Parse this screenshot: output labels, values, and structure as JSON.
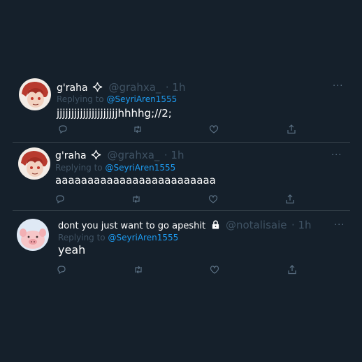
{
  "tweets": [
    {
      "display_name": "g'raha",
      "handle": "@grahxa_",
      "time": "· 1h",
      "replying_prefix": "Replying to ",
      "replying_to": "@SeyriAren1555",
      "text": "jjjjjjjjjjjjjjjjjjjjjhhhhg;//2;",
      "more": "···",
      "icons": [
        "reply-icon",
        "retweet-icon",
        "like-icon",
        "share-icon"
      ]
    },
    {
      "display_name": "g'raha",
      "handle": "@grahxa_",
      "time": "· 1h",
      "replying_prefix": "Replying to ",
      "replying_to": "@SeyriAren1555",
      "text": "aaaaaaaaaaaaaaaaaaaaaaaaa",
      "more": "···",
      "icons": [
        "reply-icon",
        "retweet-icon",
        "like-icon",
        "share-icon"
      ]
    },
    {
      "display_name": "dont you just want to go apeshit",
      "handle": "@notalisaie",
      "time": "· 1h",
      "replying_prefix": "Replying to ",
      "replying_to": "@SeyriAren1555",
      "text": "yeah",
      "more": "···",
      "icons": [
        "reply-icon",
        "retweet-icon",
        "like-icon",
        "share-icon"
      ]
    }
  ],
  "colors": {
    "background": "#15202b",
    "muted": "#3f5263",
    "mention": "#1d9bf0",
    "divider": "#38444d",
    "icon": "#5b7083"
  }
}
